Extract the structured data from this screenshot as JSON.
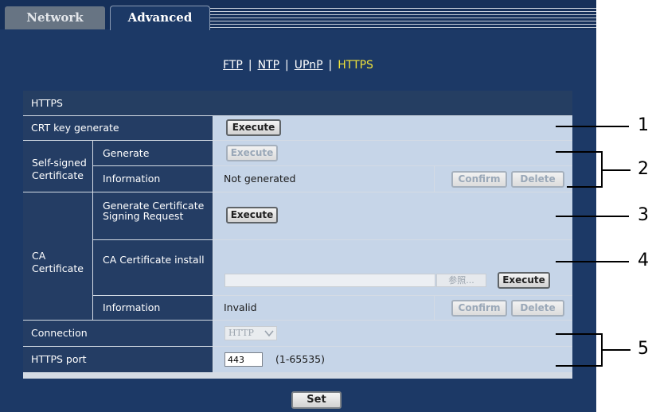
{
  "tabs": {
    "network": "Network",
    "advanced": "Advanced"
  },
  "subnav": {
    "ftp": "FTP",
    "ntp": "NTP",
    "upnp": "UPnP",
    "https": "HTTPS",
    "sep": "|"
  },
  "section": {
    "title": "HTTPS"
  },
  "rows": {
    "crt_key_generate": {
      "label": "CRT key generate",
      "button": "Execute"
    },
    "self_signed": {
      "group_label": "Self-signed Certificate",
      "generate": {
        "label": "Generate",
        "button": "Execute"
      },
      "information": {
        "label": "Information",
        "value": "Not generated",
        "confirm": "Confirm",
        "delete": "Delete"
      }
    },
    "ca": {
      "group_label": "CA Certificate",
      "csr": {
        "label": "Generate Certificate Signing Request",
        "button": "Execute"
      },
      "install": {
        "label": "CA Certificate install",
        "browse": "参照...",
        "button": "Execute"
      },
      "information": {
        "label": "Information",
        "value": "Invalid",
        "confirm": "Confirm",
        "delete": "Delete"
      }
    },
    "connection": {
      "label": "Connection",
      "value": "HTTP"
    },
    "https_port": {
      "label": "HTTPS port",
      "value": "443",
      "range": "(1-65535)"
    }
  },
  "set_button": "Set",
  "callouts": [
    "1",
    "2",
    "3",
    "4",
    "5"
  ]
}
